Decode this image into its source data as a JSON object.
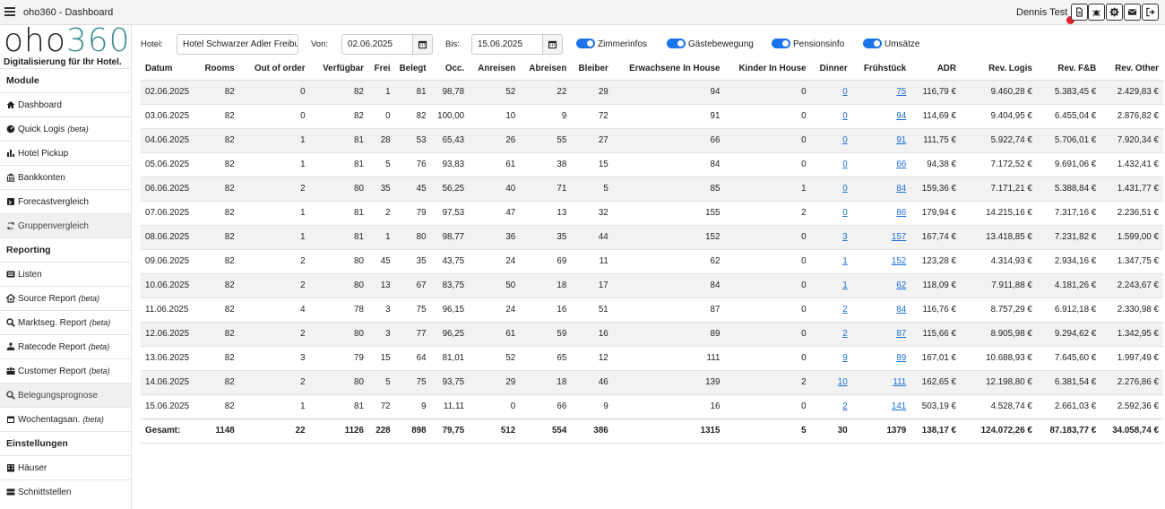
{
  "app": {
    "title": "oho360 - Dashboard",
    "user": "Dennis Test"
  },
  "logo": {
    "text_a": "oho",
    "text_b": "360",
    "tagline": "Digitalisierung für Ihr Hotel."
  },
  "sidebar": {
    "section_module": "Module",
    "section_reporting": "Reporting",
    "section_settings": "Einstellungen",
    "items": [
      {
        "label": "Dashboard",
        "beta": "",
        "icon": "home-icon"
      },
      {
        "label": "Quick Logis",
        "beta": "(beta)",
        "icon": "speedometer-icon"
      },
      {
        "label": "Hotel Pickup",
        "beta": "",
        "icon": "bar-chart-icon"
      },
      {
        "label": "Bankkonten",
        "beta": "",
        "icon": "bank-icon"
      },
      {
        "label": "Forecastvergleich",
        "beta": "",
        "icon": "forecast-icon"
      },
      {
        "label": "Gruppenvergleich",
        "beta": "",
        "icon": "group-compare-icon"
      },
      {
        "label": "Listen",
        "beta": "",
        "icon": "list-icon"
      },
      {
        "label": "Source Report",
        "beta": "(beta)",
        "icon": "source-icon"
      },
      {
        "label": "Marktseg. Report",
        "beta": "(beta)",
        "icon": "magnifier-icon"
      },
      {
        "label": "Ratecode Report",
        "beta": "(beta)",
        "icon": "ratecode-icon"
      },
      {
        "label": "Customer Report",
        "beta": "(beta)",
        "icon": "users-icon"
      },
      {
        "label": "Belegungsprognose",
        "beta": "",
        "icon": "forecast-search-icon"
      },
      {
        "label": "Wochentagsan.",
        "beta": "(beta)",
        "icon": "calendar-icon"
      },
      {
        "label": "Häuser",
        "beta": "",
        "icon": "building-icon"
      },
      {
        "label": "Schnittstellen",
        "beta": "",
        "icon": "server-icon"
      }
    ]
  },
  "filters": {
    "hotel_label": "Hotel:",
    "hotel_value": "Hotel Schwarzer Adler Freiburg",
    "from_label": "Von:",
    "from_value": "02.06.2025",
    "to_label": "Bis:",
    "to_value": "15.06.2025",
    "toggles": [
      {
        "label": "Zimmerinfos",
        "on": true
      },
      {
        "label": "Gästebewegung",
        "on": true
      },
      {
        "label": "Pensionsinfo",
        "on": true
      },
      {
        "label": "Umsätze",
        "on": true
      }
    ]
  },
  "table": {
    "columns": [
      "Datum",
      "Rooms",
      "Out of order",
      "Verfügbar",
      "Frei",
      "Belegt",
      "Occ.",
      "Anreisen",
      "Abreisen",
      "Bleiber",
      "Erwachsene In House",
      "Kinder In House",
      "Dinner",
      "Frühstück",
      "ADR",
      "Rev. Logis",
      "Rev. F&B",
      "Rev. Other"
    ],
    "rows": [
      [
        "02.06.2025",
        "82",
        "0",
        "82",
        "1",
        "81",
        "98,78",
        "52",
        "22",
        "29",
        "94",
        "0",
        "0",
        "75",
        "116,79 €",
        "9.460,28 €",
        "5.383,45 €",
        "2.429,83 €"
      ],
      [
        "03.06.2025",
        "82",
        "0",
        "82",
        "0",
        "82",
        "100,00",
        "10",
        "9",
        "72",
        "91",
        "0",
        "0",
        "94",
        "114,69 €",
        "9.404,95 €",
        "6.455,04 €",
        "2.876,82 €"
      ],
      [
        "04.06.2025",
        "82",
        "1",
        "81",
        "28",
        "53",
        "65,43",
        "26",
        "55",
        "27",
        "66",
        "0",
        "0",
        "91",
        "111,75 €",
        "5.922,74 €",
        "5.706,01 €",
        "7.920,34 €"
      ],
      [
        "05.06.2025",
        "82",
        "1",
        "81",
        "5",
        "76",
        "93,83",
        "61",
        "38",
        "15",
        "84",
        "0",
        "0",
        "66",
        "94,38 €",
        "7.172,52 €",
        "9.691,06 €",
        "1.432,41 €"
      ],
      [
        "06.06.2025",
        "82",
        "2",
        "80",
        "35",
        "45",
        "56,25",
        "40",
        "71",
        "5",
        "85",
        "1",
        "0",
        "84",
        "159,36 €",
        "7.171,21 €",
        "5.388,84 €",
        "1.431,77 €"
      ],
      [
        "07.06.2025",
        "82",
        "1",
        "81",
        "2",
        "79",
        "97,53",
        "47",
        "13",
        "32",
        "155",
        "2",
        "0",
        "86",
        "179,94 €",
        "14.215,16 €",
        "7.317,16 €",
        "2.236,51 €"
      ],
      [
        "08.06.2025",
        "82",
        "1",
        "81",
        "1",
        "80",
        "98,77",
        "36",
        "35",
        "44",
        "152",
        "0",
        "3",
        "157",
        "167,74 €",
        "13.418,85 €",
        "7.231,82 €",
        "1.599,00 €"
      ],
      [
        "09.06.2025",
        "82",
        "2",
        "80",
        "45",
        "35",
        "43,75",
        "24",
        "69",
        "11",
        "62",
        "0",
        "1",
        "152",
        "123,28 €",
        "4.314,93 €",
        "2.934,16 €",
        "1.347,75 €"
      ],
      [
        "10.06.2025",
        "82",
        "2",
        "80",
        "13",
        "67",
        "83,75",
        "50",
        "18",
        "17",
        "84",
        "0",
        "1",
        "62",
        "118,09 €",
        "7.911,88 €",
        "4.181,26 €",
        "2.243,67 €"
      ],
      [
        "11.06.2025",
        "82",
        "4",
        "78",
        "3",
        "75",
        "96,15",
        "24",
        "16",
        "51",
        "87",
        "0",
        "2",
        "84",
        "116,76 €",
        "8.757,29 €",
        "6.912,18 €",
        "2.330,98 €"
      ],
      [
        "12.06.2025",
        "82",
        "2",
        "80",
        "3",
        "77",
        "96,25",
        "61",
        "59",
        "16",
        "89",
        "0",
        "2",
        "87",
        "115,66 €",
        "8.905,98 €",
        "9.294,62 €",
        "1.342,95 €"
      ],
      [
        "13.06.2025",
        "82",
        "3",
        "79",
        "15",
        "64",
        "81,01",
        "52",
        "65",
        "12",
        "111",
        "0",
        "9",
        "89",
        "167,01 €",
        "10.688,93 €",
        "7.645,60 €",
        "1.997,49 €"
      ],
      [
        "14.06.2025",
        "82",
        "2",
        "80",
        "5",
        "75",
        "93,75",
        "29",
        "18",
        "46",
        "139",
        "2",
        "10",
        "111",
        "162,65 €",
        "12.198,80 €",
        "6.381,54 €",
        "2.276,86 €"
      ],
      [
        "15.06.2025",
        "82",
        "1",
        "81",
        "72",
        "9",
        "11,11",
        "0",
        "66",
        "9",
        "16",
        "0",
        "2",
        "141",
        "503,19 €",
        "4.528,74 €",
        "2.661,03 €",
        "2.592,36 €"
      ]
    ],
    "total": [
      "Gesamt:",
      "1148",
      "22",
      "1126",
      "228",
      "898",
      "79,75",
      "512",
      "554",
      "386",
      "1315",
      "5",
      "30",
      "1379",
      "138,17 €",
      "124.072,26 €",
      "87.183,77 €",
      "34.058,74 €"
    ]
  }
}
